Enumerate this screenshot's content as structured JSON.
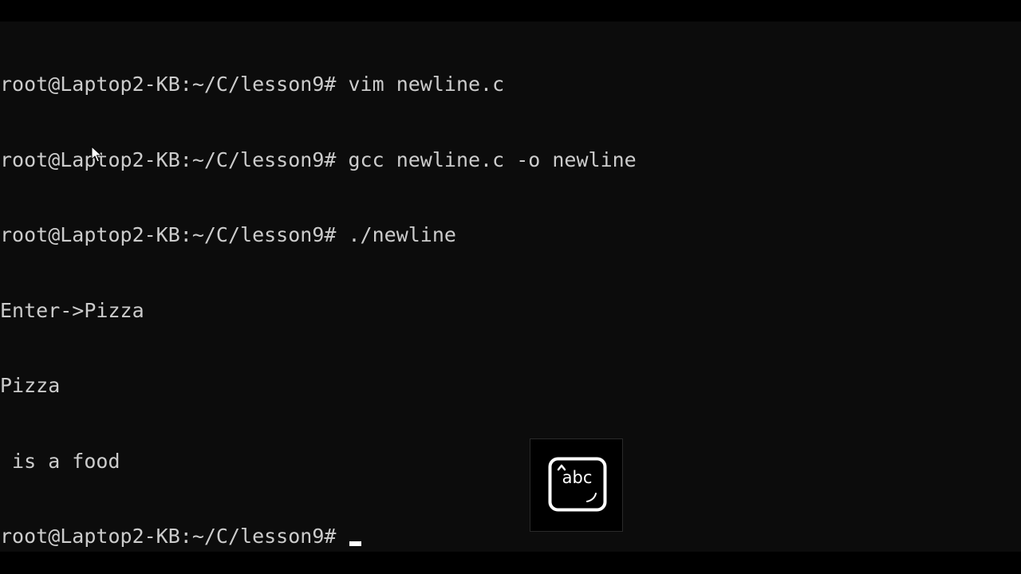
{
  "terminal": {
    "lines": [
      "root@Laptop2-KB:~/C/lesson9# vim newline.c",
      "root@Laptop2-KB:~/C/lesson9# gcc newline.c -o newline",
      "root@Laptop2-KB:~/C/lesson9# ./newline",
      "Enter->Pizza",
      "Pizza",
      " is a food"
    ],
    "prompt": "root@Laptop2-KB:~/C/lesson9# "
  },
  "ime": {
    "label": "abc",
    "icon": "keyboard-ime-icon"
  },
  "colors": {
    "background": "#0c0c0c",
    "text": "#cccccc",
    "cursor": "#ffffff"
  }
}
